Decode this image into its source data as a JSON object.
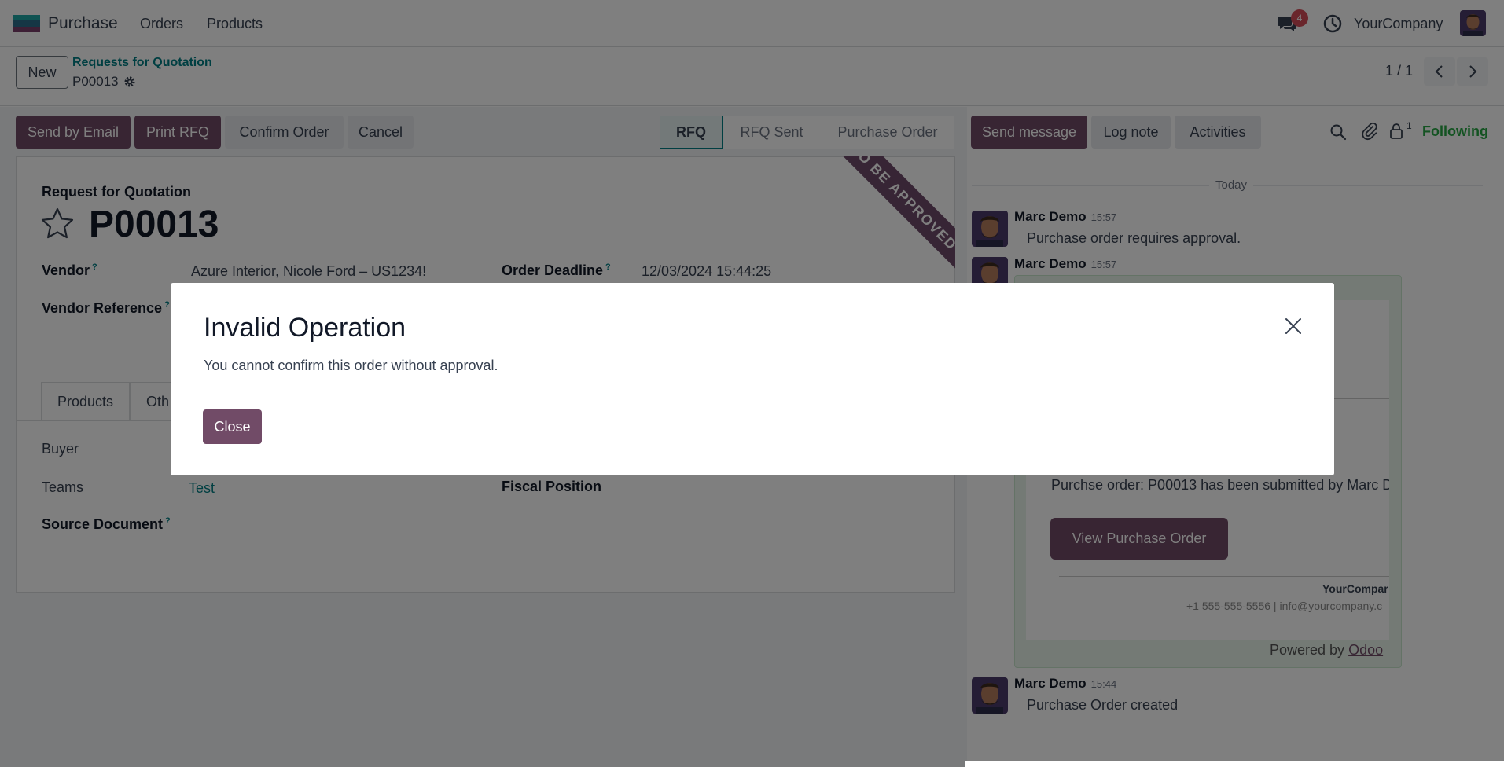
{
  "navbar": {
    "app_name": "Purchase",
    "menu": [
      "Orders",
      "Products"
    ],
    "notification_count": "4",
    "company": "YourCompany"
  },
  "control_panel": {
    "new_label": "New",
    "breadcrumb_parent": "Requests for Quotation",
    "breadcrumb_current": "P00013",
    "pager": "1 / 1"
  },
  "actions": {
    "send_email": "Send by Email",
    "print_rfq": "Print RFQ",
    "confirm_order": "Confirm Order",
    "cancel": "Cancel"
  },
  "statusbar": [
    "RFQ",
    "RFQ Sent",
    "Purchase Order"
  ],
  "form": {
    "ribbon": "TO BE APPROVED",
    "doc_type": "Request for Quotation",
    "doc_number": "P00013",
    "vendor_label": "Vendor",
    "vendor_value": "Azure Interior, Nicole Ford – US1234!",
    "deadline_label": "Order Deadline",
    "deadline_value": "12/03/2024 15:44:25",
    "vendor_ref_label": "Vendor Reference",
    "tabs": [
      "Products",
      "Oth"
    ],
    "buyer_label": "Buyer",
    "teams_label": "Teams",
    "teams_value": "Test",
    "fiscal_label": "Fiscal Position",
    "source_label": "Source Document",
    "help_mark": "?"
  },
  "chatter": {
    "send_message": "Send message",
    "log_note": "Log note",
    "activities": "Activities",
    "follower_count": "1",
    "following": "Following",
    "today": "Today",
    "messages": [
      {
        "author": "Marc Demo",
        "time": "15:57",
        "body": "Purchase order requires approval."
      },
      {
        "author": "Marc Demo",
        "time": "15:57",
        "body": ""
      },
      {
        "author": "Marc Demo",
        "time": "15:44",
        "body": "Purchase Order created"
      }
    ],
    "mail": {
      "text": "Purchse order: P00013 has been submitted by Marc D",
      "button": "View Purchase Order",
      "company": "YourCompar",
      "contact": "+1 555-555-5556 | info@yourcompany.c",
      "powered_prefix": "Powered by",
      "powered_link": "Odoo"
    }
  },
  "modal": {
    "title": "Invalid Operation",
    "body": "You cannot confirm this order without approval.",
    "close_label": "Close"
  },
  "colors": {
    "brand": "#714b67",
    "accent": "#017e84"
  }
}
